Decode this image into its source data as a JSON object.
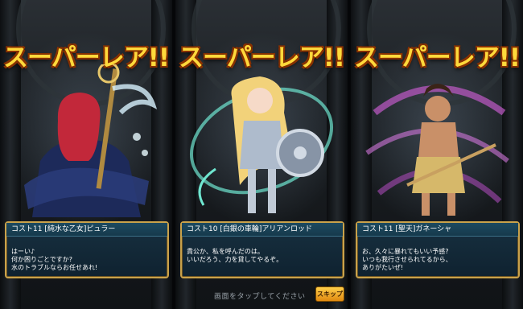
{
  "banner_text": "スーパーレア!!",
  "cards": [
    {
      "header": "コスト11 [純水な乙女]ピュラー",
      "line1": "はーい♪",
      "line2": "何か困りごとですか?",
      "line3": "水のトラブルならお任せあれ!"
    },
    {
      "header": "コスト10 [白銀の車輪]アリアンロッド",
      "line1": "貴公か、私を呼んだのは。",
      "line2": "いいだろう、力を貸してやるぞ。",
      "line3": ""
    },
    {
      "header": "コスト11 [聖天]ガネーシャ",
      "line1": "お、久々に暴れてもいい予感?",
      "line2": "いつも我行させられてるから、",
      "line3": "ありがたいぜ!"
    }
  ],
  "bottom_hint": "画面をタップしてください",
  "skip_label": "スキップ",
  "colors": {
    "banner": "#ffd93b",
    "infobox_border": "#c9a24b",
    "skip_button": "#f0a020"
  }
}
